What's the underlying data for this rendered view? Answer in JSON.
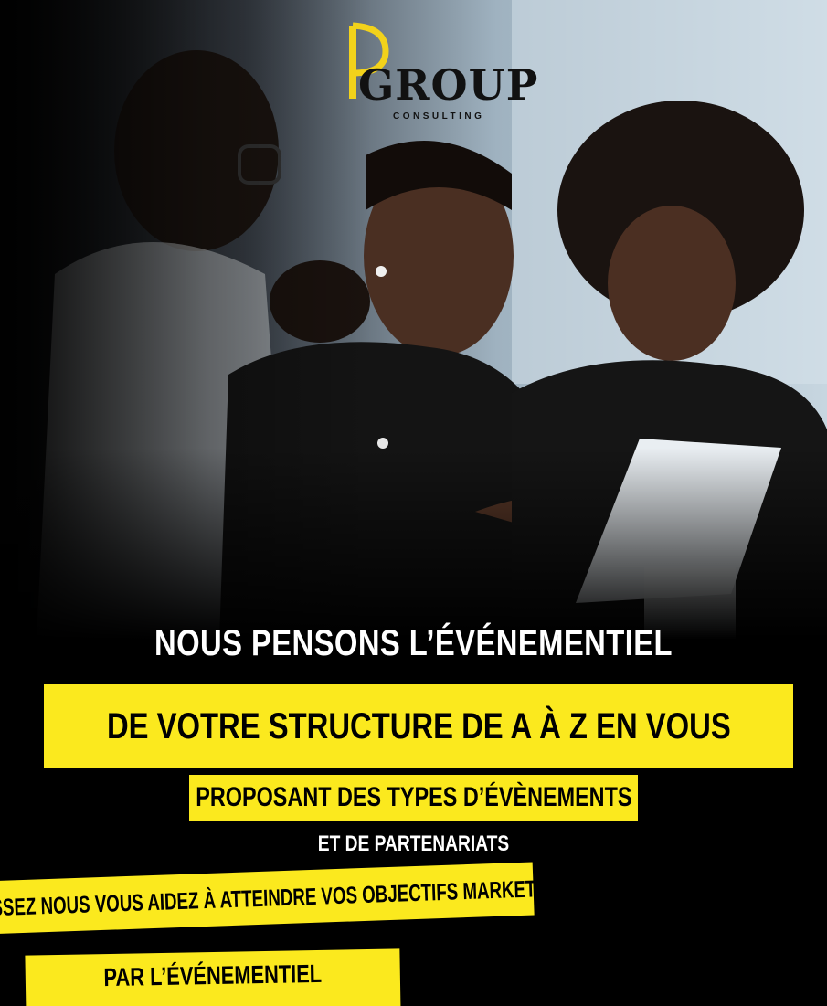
{
  "logo": {
    "letter": "P",
    "word": "GROUP",
    "sub": "CONSULTING",
    "accent": "#f2d21b"
  },
  "photo": {
    "description_icon": "team-meeting-photo"
  },
  "headline": "NOUS PENSONS L’ÉVÉNEMENTIEL",
  "band_main": "DE VOTRE STRUCTURE DE A À Z EN VOUS",
  "band_sub": "PROPOSANT DES TYPES D’ÉVÈNEMENTS",
  "line3": "ET DE PARTENARIATS",
  "cta_line1": "LAISSEZ NOUS VOUS AIDEZ À ATTEINDRE VOS OBJECTIFS MARKETING",
  "cta_line2": "PAR L’ÉVÉNEMENTIEL",
  "colors": {
    "yellow": "#fbe91e",
    "background": "#000000",
    "text_light": "#ffffff"
  }
}
